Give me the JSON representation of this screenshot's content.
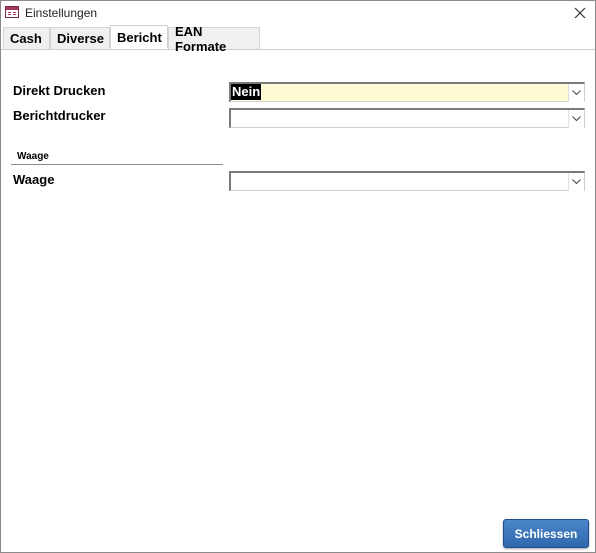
{
  "window": {
    "title": "Einstellungen"
  },
  "tabs": [
    {
      "label": "Cash"
    },
    {
      "label": "Diverse"
    },
    {
      "label": "Bericht",
      "active": true
    },
    {
      "label": "EAN Formate"
    }
  ],
  "form": {
    "direkt_drucken": {
      "label": "Direkt Drucken",
      "value": "Nein"
    },
    "berichtdrucker": {
      "label": "Berichtdrucker",
      "value": ""
    },
    "waage_section": {
      "title": "Waage"
    },
    "waage": {
      "label": "Waage",
      "value": ""
    }
  },
  "footer": {
    "close_label": "Schliessen"
  },
  "colors": {
    "highlight_field": "#fffbd5",
    "button_blue": "#3a74b9"
  },
  "icons": {
    "app": "form-icon",
    "close": "close-icon",
    "dropdown": "chevron-down-icon"
  }
}
